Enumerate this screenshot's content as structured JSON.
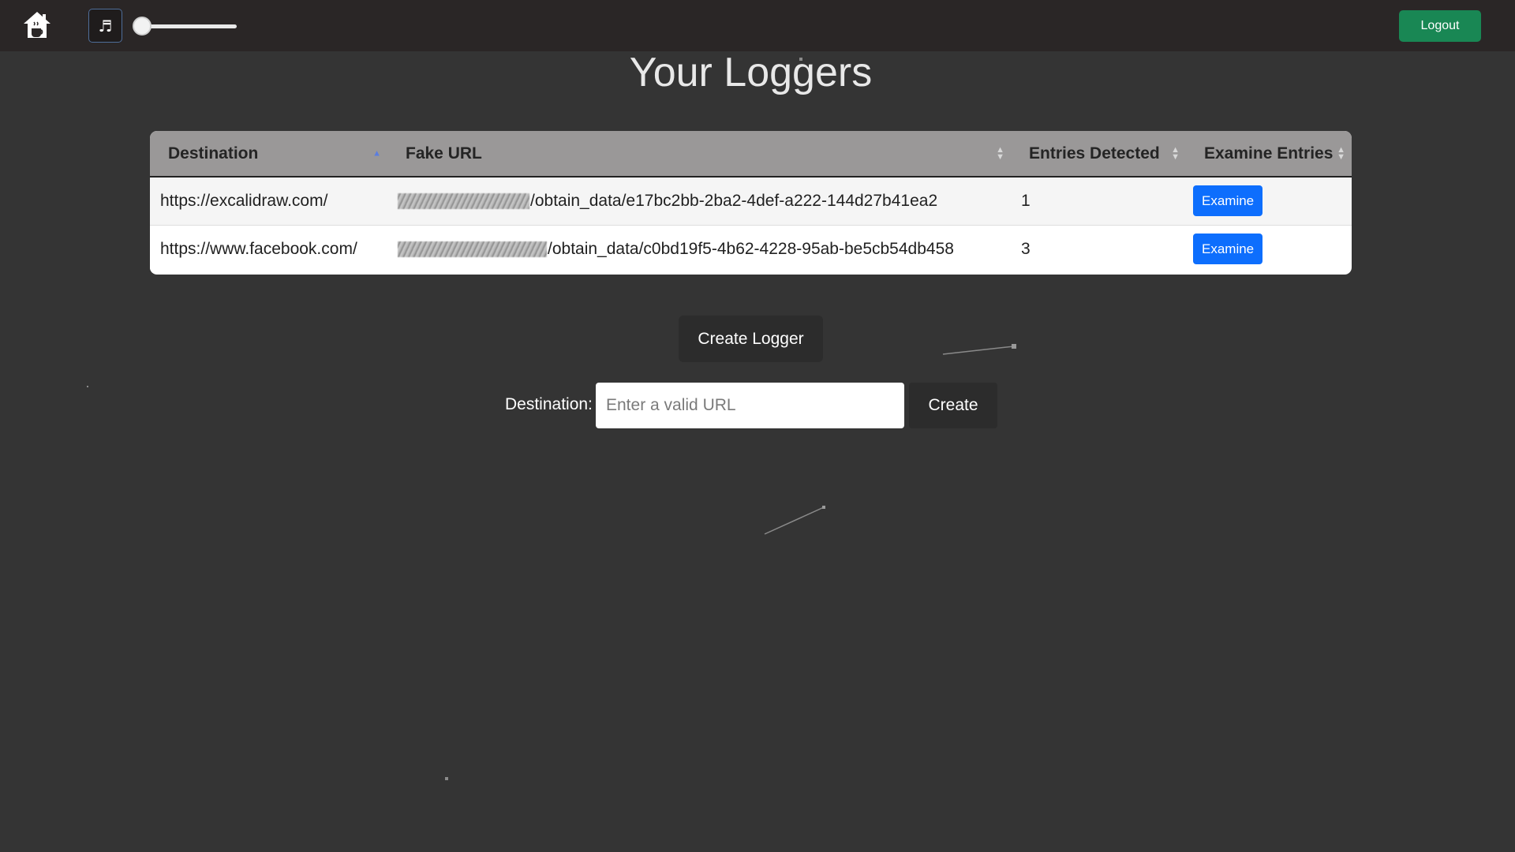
{
  "navbar": {
    "home_icon": "home-icon",
    "music_icon": "music-note-icon",
    "music_symbol": "♬",
    "volume_level": 0,
    "logout_label": "Logout"
  },
  "main": {
    "title": "Your Loggers",
    "table": {
      "headers": {
        "destination": "Destination",
        "fake_url": "Fake URL",
        "entries_detected": "Entries Detected",
        "examine_entries": "Examine Entries"
      },
      "sort": {
        "column": "Destination",
        "direction": "ascending"
      },
      "rows": [
        {
          "destination": "https://excalidraw.com/",
          "fake_url_suffix": "/obtain_data/e17bc2bb-2ba2-4def-a222-144d27b41ea2",
          "entries": "1",
          "examine_label": "Examine"
        },
        {
          "destination": "https://www.facebook.com/",
          "fake_url_suffix": "/obtain_data/c0bd19f5-4b62-4228-95ab-be5cb54db458",
          "entries": "3",
          "examine_label": "Examine"
        }
      ]
    },
    "create_logger_label": "Create Logger",
    "form": {
      "destination_label": "Destination:",
      "destination_placeholder": "Enter a valid URL",
      "destination_value": "",
      "create_label": "Create"
    }
  },
  "colors": {
    "background": "#343434",
    "navbar": "#2a2626",
    "logout": "#198754",
    "examine": "#0d6efd",
    "table_header": "#9a9898"
  }
}
